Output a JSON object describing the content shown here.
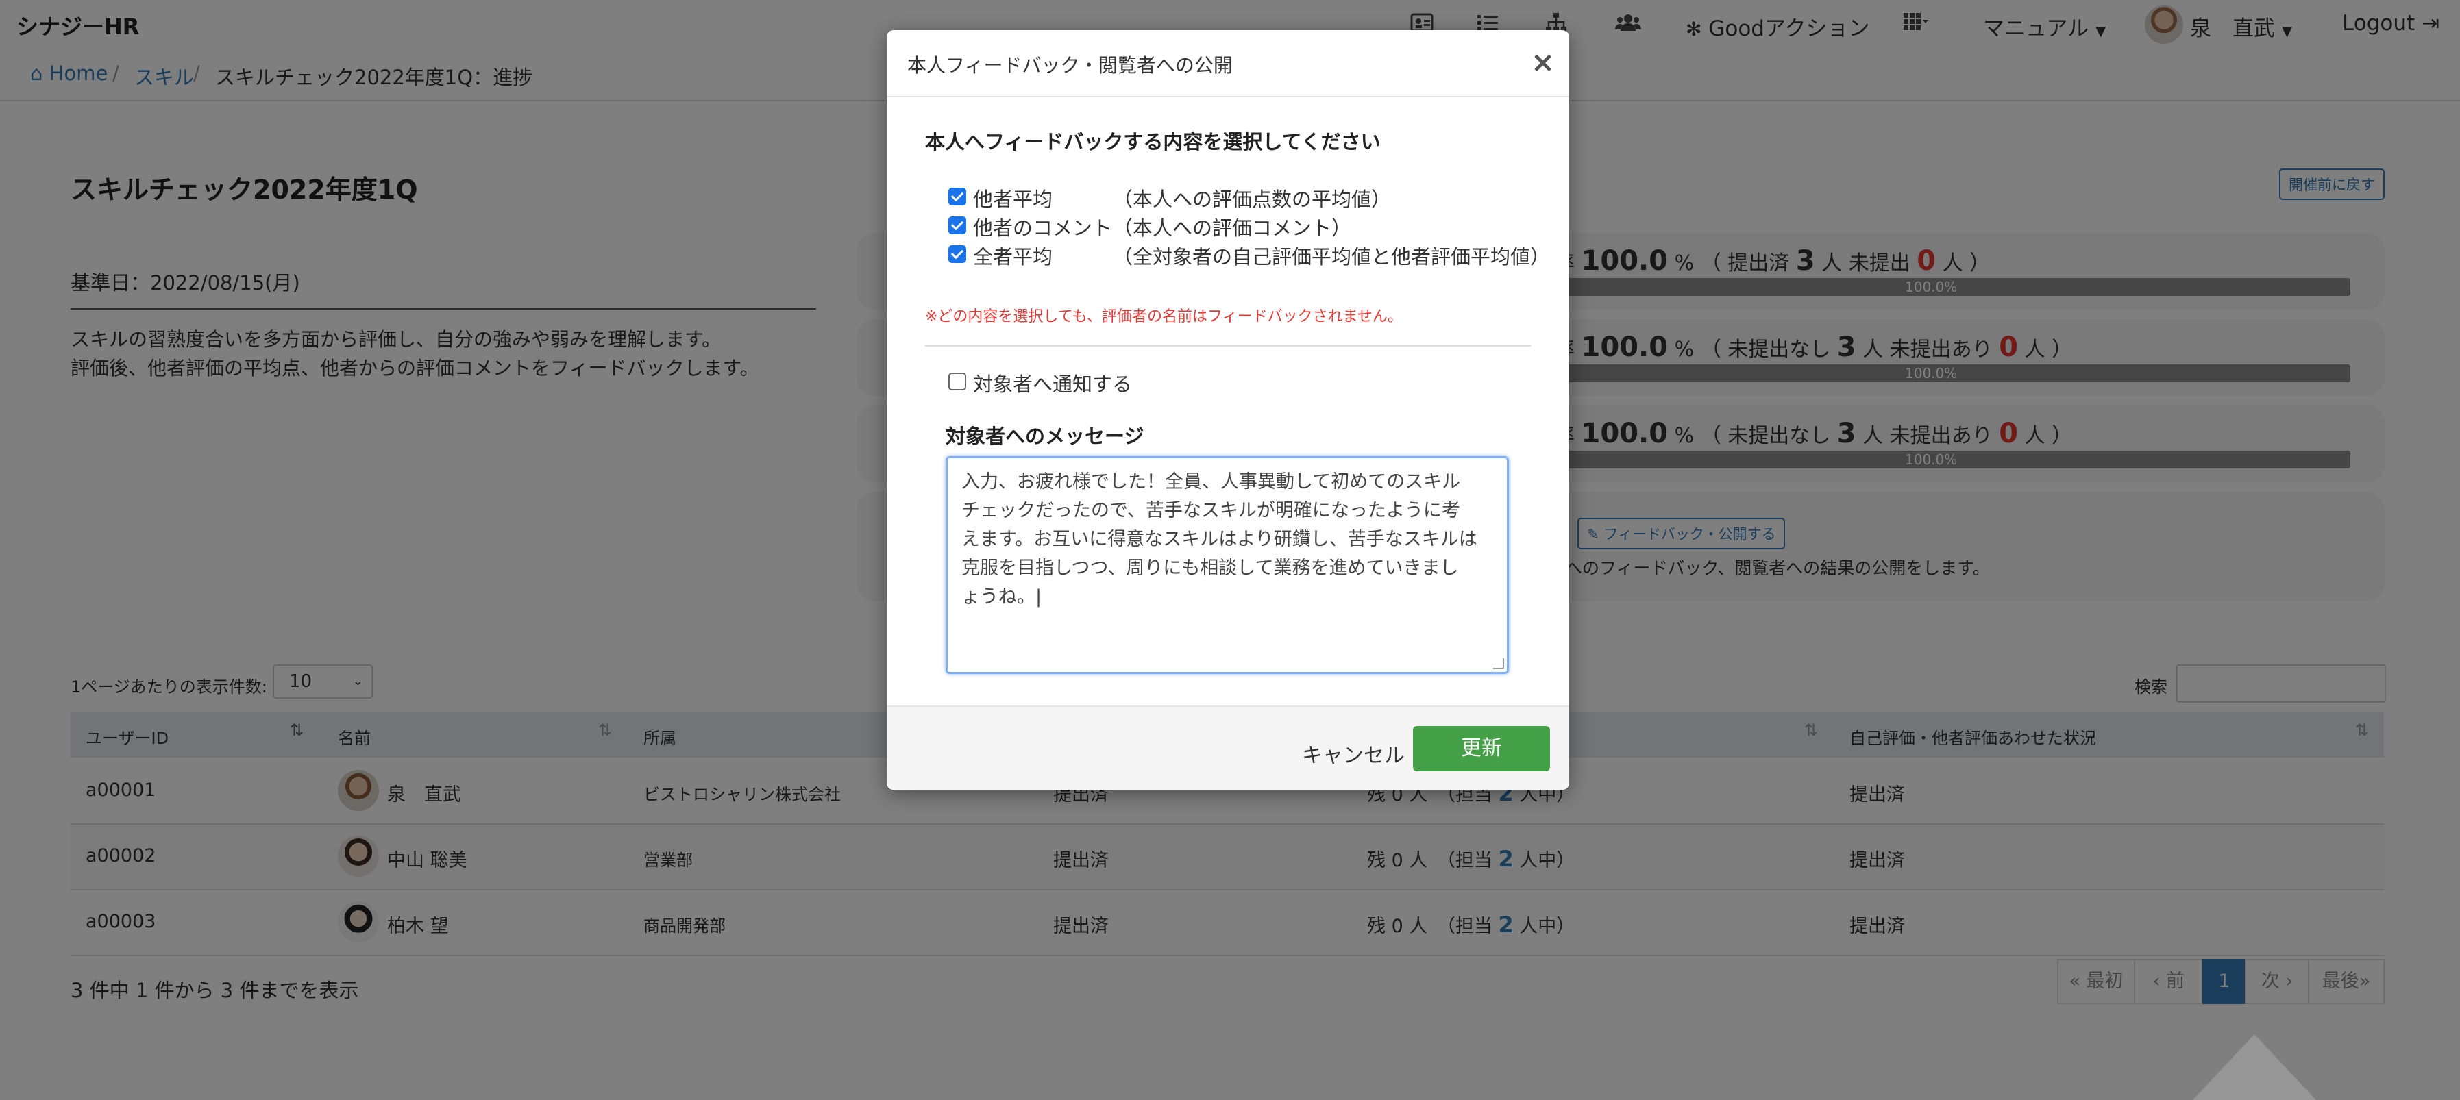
{
  "navbar": {
    "brand": "シナジーHR",
    "icons": [
      "id-card-icon",
      "list-icon",
      "sitemap-icon",
      "users-icon"
    ],
    "good_action": "Goodアクション",
    "manual": "マニュアル",
    "user_name": "泉　直武",
    "logout": "Logout"
  },
  "breadcrumb": {
    "home": "Home",
    "skill": "スキル",
    "current": "スキルチェック2022年度1Q：進捗"
  },
  "page": {
    "title": "スキルチェック2022年度1Q",
    "reset_button": "開催前に戻す",
    "kijun": "基準日：2022/08/15(月)",
    "desc_line1": "スキルの習熟度合いを多方面から評価し、自分の強みや弱みを理解します。",
    "desc_line2": "評価後、他者評価の平均点、他者からの評価コメントをフィードバックします。"
  },
  "progress": [
    {
      "prefix": "率",
      "percent": "100.0",
      "pct_sign": "%",
      "open": "（",
      "label_a": "提出済",
      "count_a": "3",
      "unit_a": "人",
      "label_b": "未提出",
      "count_b": "0",
      "unit_b": "人",
      "close": "）",
      "bar_label": "100.0%",
      "value": 1.0
    },
    {
      "prefix": "率",
      "percent": "100.0",
      "pct_sign": "%",
      "open": "（",
      "label_a": "未提出なし",
      "count_a": "3",
      "unit_a": "人",
      "label_b": "未提出あり",
      "count_b": "0",
      "unit_b": "人",
      "close": "）",
      "bar_label": "100.0%",
      "value": 1.0
    },
    {
      "prefix": "率",
      "percent": "100.0",
      "pct_sign": "%",
      "open": "（",
      "label_a": "未提出なし",
      "count_a": "3",
      "unit_a": "人",
      "label_b": "未提出あり",
      "count_b": "0",
      "unit_b": "人",
      "close": "）",
      "bar_label": "100.0%",
      "value": 1.0
    }
  ],
  "feedback_card": {
    "button": "フィードバック・公開する",
    "text": "へのフィードバック、閲覧者への結果の公開をします。"
  },
  "table_controls": {
    "per_page_label": "1ページあたりの表示件数:",
    "per_page_value": "10",
    "search_label": "検索"
  },
  "table": {
    "headers": [
      "ユーザーID",
      "名前",
      "所属",
      "自己評価・他者評価あわせた状況"
    ],
    "rows": [
      {
        "id": "a00001",
        "name": "泉　直武",
        "dept": "ビストロシャリン株式会社",
        "self": "提出済",
        "remain": "残 0 人",
        "assign_pre": "（担当",
        "assign_num": "2",
        "assign_post": "人中）",
        "overall": "提出済"
      },
      {
        "id": "a00002",
        "name": "中山 聡美",
        "dept": "営業部",
        "self": "提出済",
        "remain": "残 0 人",
        "assign_pre": "（担当",
        "assign_num": "2",
        "assign_post": "人中）",
        "overall": "提出済"
      },
      {
        "id": "a00003",
        "name": "柏木 望",
        "dept": "商品開発部",
        "self": "提出済",
        "remain": "残 0 人",
        "assign_pre": "（担当",
        "assign_num": "2",
        "assign_post": "人中）",
        "overall": "提出済"
      }
    ]
  },
  "table_info": "3 件中 1 件から 3 件までを表示",
  "pagination": [
    "« 最初",
    "‹ 前",
    "1",
    "次 ›",
    "最後»"
  ],
  "modal": {
    "title": "本人フィードバック・閲覧者への公開",
    "close": "×",
    "section_title": "本人へフィードバックする内容を選択してください",
    "options": [
      {
        "label": "他者平均",
        "desc": "（本人への評価点数の平均値）",
        "checked": true
      },
      {
        "label": "他者のコメント",
        "desc": "（本人への評価コメント）",
        "checked": true
      },
      {
        "label": "全者平均",
        "desc": "（全対象者の自己評価平均値と他者評価平均値）",
        "checked": true
      }
    ],
    "note": "※どの内容を選択しても、評価者の名前はフィードバックされません。",
    "notify_label": "対象者へ通知する",
    "notify_checked": false,
    "message_label": "対象者へのメッセージ",
    "message_lines": [
      "入力、お疲れ様でした！全員、人事異動して初めてのスキル",
      "チェックだったので、苦手なスキルが明確になったように考",
      "えます。お互いに得意なスキルはより研鑽し、苦手なスキルは",
      "克服を目指しつつ、周りにも相談して業務を進めていきまし",
      "ょうね。|"
    ],
    "cancel": "キャンセル",
    "update": "更新"
  }
}
